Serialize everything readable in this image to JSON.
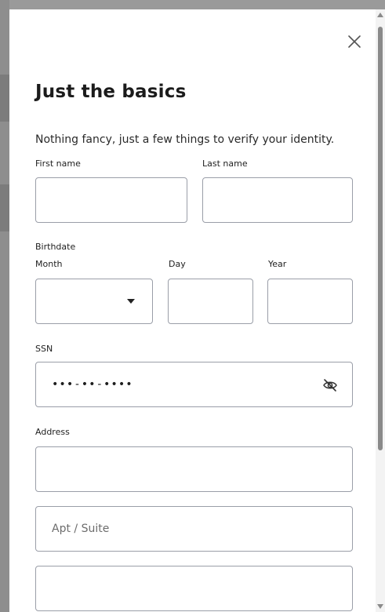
{
  "modal": {
    "title": "Just the basics",
    "subtitle": "Nothing fancy, just a few things to verify your identity."
  },
  "fields": {
    "first_name": {
      "label": "First name",
      "value": ""
    },
    "last_name": {
      "label": "Last name",
      "value": ""
    },
    "birthdate": {
      "group_label": "Birthdate",
      "month": {
        "label": "Month",
        "selected": ""
      },
      "day": {
        "label": "Day",
        "value": ""
      },
      "year": {
        "label": "Year",
        "value": ""
      }
    },
    "ssn": {
      "label": "SSN",
      "masked_value": "•••-••-••••"
    },
    "address": {
      "label": "Address",
      "line1": "",
      "apt_placeholder": "Apt / Suite",
      "line3": ""
    }
  },
  "icons": {
    "close": "close-icon",
    "dropdown": "chevron-down-icon",
    "visibility": "eye-off-icon"
  },
  "colors": {
    "background_overlay": "#8f8f8f",
    "modal_background": "#ffffff",
    "input_border": "#9a9ea8",
    "text": "#1c1c1c"
  }
}
